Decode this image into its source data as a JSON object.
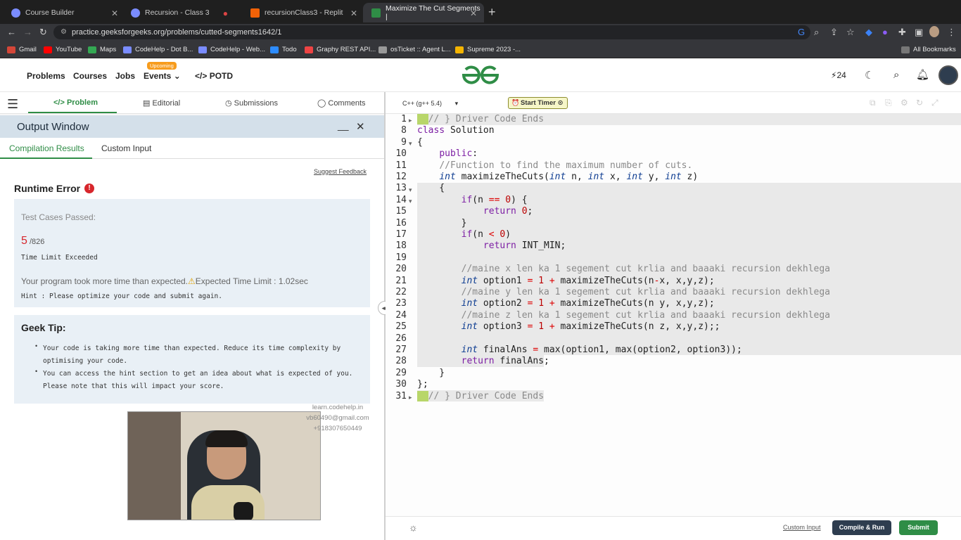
{
  "browser": {
    "tabs": [
      {
        "title": "Course Builder",
        "active": false
      },
      {
        "title": "Recursion - Class 3",
        "active": false
      },
      {
        "title": "",
        "active": false
      },
      {
        "title": "recursionClass3 - Replit",
        "active": false
      },
      {
        "title": "Maximize The Cut Segments |",
        "active": true
      }
    ],
    "url": "practice.geeksforgeeks.org/problems/cutted-segments1642/1",
    "bookmarks": [
      "Gmail",
      "YouTube",
      "Maps",
      "CodeHelp - Dot B...",
      "CodeHelp - Web...",
      "Todo",
      "Graphy REST API...",
      "osTicket :: Agent L...",
      "Supreme 2023 -..."
    ],
    "all_bookmarks": "All Bookmarks"
  },
  "header": {
    "nav": {
      "problems": "Problems",
      "courses": "Courses",
      "jobs": "Jobs",
      "events": "Events",
      "potd": "POTD"
    },
    "upcoming_badge": "Upcoming",
    "streak": "24"
  },
  "left_tabs": {
    "problem": "Problem",
    "editorial": "Editorial",
    "submissions": "Submissions",
    "comments": "Comments"
  },
  "output": {
    "title": "Output Window",
    "tabs": {
      "compilation": "Compilation Results",
      "custom": "Custom Input"
    },
    "suggest_feedback": "Suggest Feedback",
    "error_title": "Runtime Error",
    "test_cases_label": "Test Cases Passed:",
    "passed": "5",
    "total": "/826",
    "status": "Time Limit Exceeded",
    "message": "Your program took more time than expected.",
    "expected": "Expected Time Limit : 1.02sec",
    "hint": "Hint : Please optimize your code and submit again.",
    "geek_tip_title": "Geek Tip:",
    "tips": [
      "Your code is taking more time than expected. Reduce its time complexity by optimising your code.",
      "You can access the hint section to get an idea about what is expected of you. Please note that this will impact your score."
    ]
  },
  "watermark": [
    "learn.codehelp.in",
    "vb60490@gmail.com",
    "+918307650449"
  ],
  "editor": {
    "language": "C++ (g++ 5.4)",
    "start_timer": "Start Timer",
    "custom_input": "Custom Input",
    "compile_run": "Compile & Run",
    "submit": "Submit"
  },
  "colors": {
    "accent": "#2f8d46",
    "error": "#d7262c"
  }
}
